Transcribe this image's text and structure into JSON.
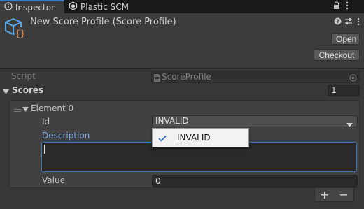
{
  "tabs": [
    {
      "label": "Inspector",
      "icon": "info-icon",
      "active": true
    },
    {
      "label": "Plastic SCM",
      "icon": "plastic-scm-icon",
      "active": false
    }
  ],
  "header": {
    "object_title": "New Score Profile (Score Profile)",
    "open_label": "Open",
    "checkout_label": "Checkout"
  },
  "script_row": {
    "label": "Script",
    "value": "ScoreProfile"
  },
  "scores": {
    "label": "Scores",
    "count": "1"
  },
  "element": {
    "label": "Element 0",
    "id_label": "Id",
    "id_value": "INVALID",
    "description_label": "Description",
    "description_value": "",
    "value_label": "Value",
    "value_value": "0"
  },
  "dropdown_popup": {
    "options": [
      "INVALID"
    ],
    "selected": "INVALID"
  },
  "list_footer": {
    "add_label": "+",
    "remove_label": "−"
  },
  "colors": {
    "accent": "#3a79bb",
    "focus_label": "#7fa9e6",
    "check": "#2f6fc1"
  }
}
